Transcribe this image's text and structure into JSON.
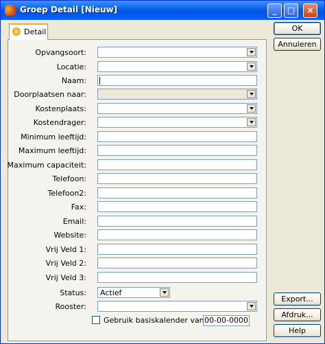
{
  "window": {
    "title": "Groep Detail [Nieuw]"
  },
  "tabs": [
    {
      "label": "Detail",
      "icon": "detail-tab-icon"
    }
  ],
  "form": {
    "opvangsoort_label": "Opvangsoort:",
    "locatie_label": "Locatie:",
    "naam_label": "Naam:",
    "doorplaatsen_label": "Doorplaatsen naar:",
    "kostenplaats_label": "Kostenplaats:",
    "kostendrager_label": "Kostendrager:",
    "min_leeftijd_label": "Minimum leeftijd:",
    "max_leeftijd_label": "Maximum leeftijd:",
    "max_capaciteit_label": "Maximum capaciteit:",
    "telefoon_label": "Telefoon:",
    "telefoon2_label": "Telefoon2:",
    "fax_label": "Fax:",
    "email_label": "Email:",
    "website_label": "Website:",
    "vrij1_label": "Vrij Veld 1:",
    "vrij2_label": "Vrij Veld 2:",
    "vrij3_label": "Vrij Veld 3:",
    "status_label": "Status:",
    "status_value": "Actief",
    "rooster_label": "Rooster:",
    "basiskalender_label": "Gebruik basiskalender vanaf:",
    "basiskalender_date": "00-00-0000"
  },
  "buttons": {
    "ok": "OK",
    "annuleren": "Annuleren",
    "export": "Export...",
    "afdruk": "Afdruk...",
    "help": "Help"
  }
}
